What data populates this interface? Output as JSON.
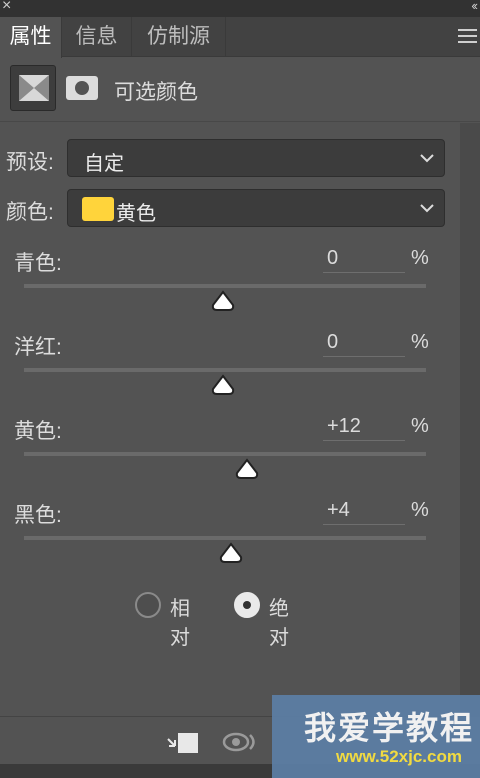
{
  "titlebar": {
    "close_glyph": "×",
    "collapse_glyph": "‹‹"
  },
  "tabs": [
    {
      "label": "属性",
      "active": true
    },
    {
      "label": "信息",
      "active": false
    },
    {
      "label": "仿制源",
      "active": false
    }
  ],
  "header": {
    "title": "可选颜色",
    "adjustment_icon": "selective-color-icon",
    "mask_icon": "layer-mask-icon"
  },
  "preset": {
    "label": "预设:",
    "value": "自定"
  },
  "colors": {
    "label": "颜色:",
    "value": "黄色",
    "swatch_color": "#ffd43b"
  },
  "sliders": [
    {
      "label": "青色:",
      "value": "0",
      "unit": "%",
      "numeric": 0
    },
    {
      "label": "洋红:",
      "value": "0",
      "unit": "%",
      "numeric": 0
    },
    {
      "label": "黄色:",
      "value": "+12",
      "unit": "%",
      "numeric": 12
    },
    {
      "label": "黑色:",
      "value": "+4",
      "unit": "%",
      "numeric": 4
    }
  ],
  "method": {
    "options": [
      {
        "label": "相对",
        "checked": false
      },
      {
        "label": "绝对",
        "checked": true
      }
    ]
  },
  "bottom": {
    "clip_icon": "clip-to-layer-icon",
    "visibility_icon": "view-previous-state-icon"
  },
  "watermark": {
    "title": "我爱学教程",
    "url": "www.52xjc.com"
  }
}
